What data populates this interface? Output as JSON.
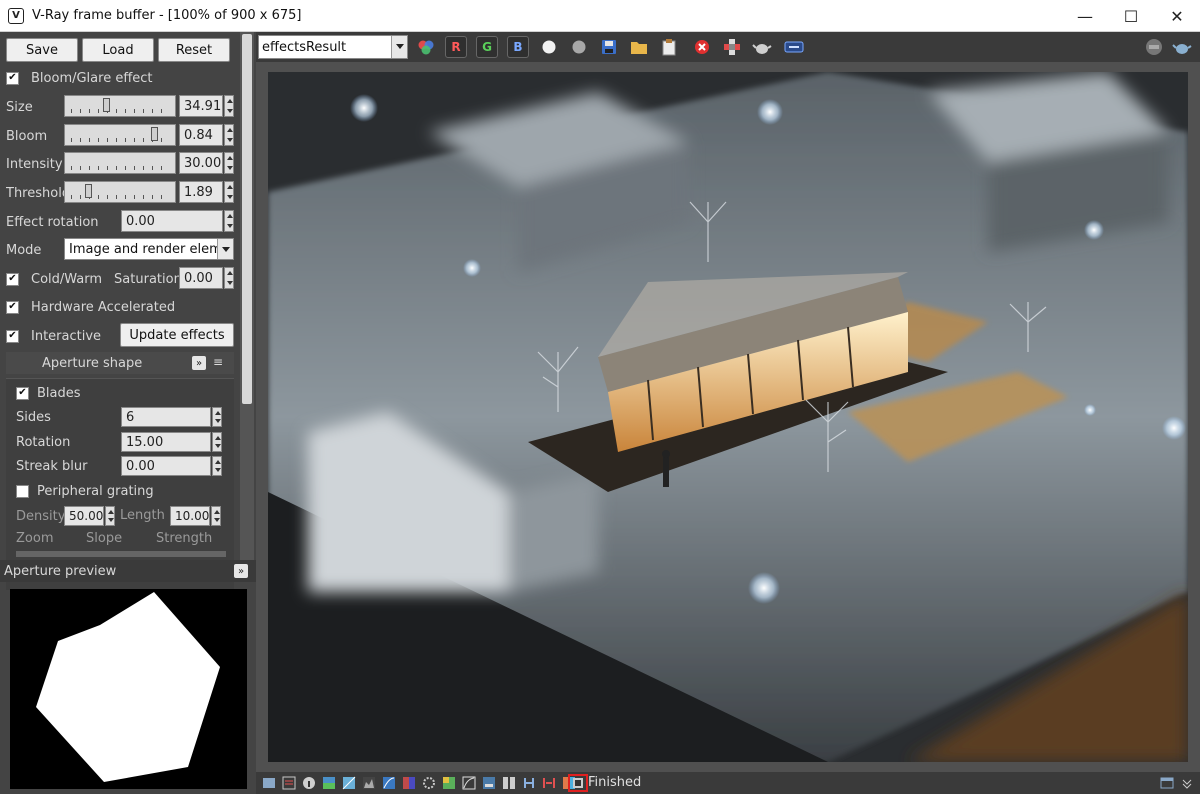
{
  "window": {
    "title": "V-Ray frame buffer - [100% of 900 x 675]",
    "app_icon_glyph": "V",
    "controls": {
      "minimize": "—",
      "maximize": "☐",
      "close": "✕"
    }
  },
  "left_panel": {
    "buttons": {
      "save": "Save",
      "load": "Load",
      "reset": "Reset"
    },
    "bloom_glare": {
      "label": "Bloom/Glare effect",
      "checked": true
    },
    "size": {
      "label": "Size",
      "value": "34.91"
    },
    "bloom": {
      "label": "Bloom",
      "value": "0.84"
    },
    "intensity": {
      "label": "Intensity",
      "value": "30.00"
    },
    "threshold": {
      "label": "Threshold",
      "value": "1.89"
    },
    "effect_rotation": {
      "label": "Effect rotation",
      "value": "0.00"
    },
    "mode": {
      "label": "Mode",
      "value": "Image and render eleme"
    },
    "cold_warm": {
      "label": "Cold/Warm",
      "checked": true
    },
    "saturation": {
      "label": "Saturation",
      "value": "0.00"
    },
    "hardware_accel": {
      "label": "Hardware Accelerated",
      "checked": true
    },
    "interactive": {
      "label": "Interactive",
      "checked": true
    },
    "update_effects": "Update effects",
    "aperture_shape": {
      "title": "Aperture shape",
      "blades": {
        "label": "Blades",
        "checked": true
      },
      "sides": {
        "label": "Sides",
        "value": "6"
      },
      "rotation": {
        "label": "Rotation",
        "value": "15.00"
      },
      "streak_blur": {
        "label": "Streak blur",
        "value": "0.00"
      },
      "peripheral_grating": {
        "label": "Peripheral grating",
        "checked": false
      },
      "density": {
        "label": "Density",
        "value": "50.00"
      },
      "length": {
        "label": "Length",
        "value": "10.00"
      },
      "zoom": "Zoom",
      "slope": "Slope",
      "strength": "Strength"
    },
    "aperture_preview": {
      "title": "Aperture preview"
    }
  },
  "toolbar": {
    "channel_select": "effectsResult",
    "r": "R",
    "g": "G",
    "b": "B",
    "icons": [
      "color-circles-icon",
      "white-dot-icon",
      "gray-dot-icon",
      "save-disk-icon",
      "folder-icon",
      "clipboard-icon",
      "stop-render-icon",
      "region-icon",
      "teapot-icon",
      "lens-icon",
      "stop-badge-icon",
      "teapot-small-icon"
    ]
  },
  "status": {
    "text": "Finished"
  },
  "colors": {
    "accent_red": "#e02020",
    "panel": "#444444",
    "toolbar": "#3a3a3a"
  }
}
